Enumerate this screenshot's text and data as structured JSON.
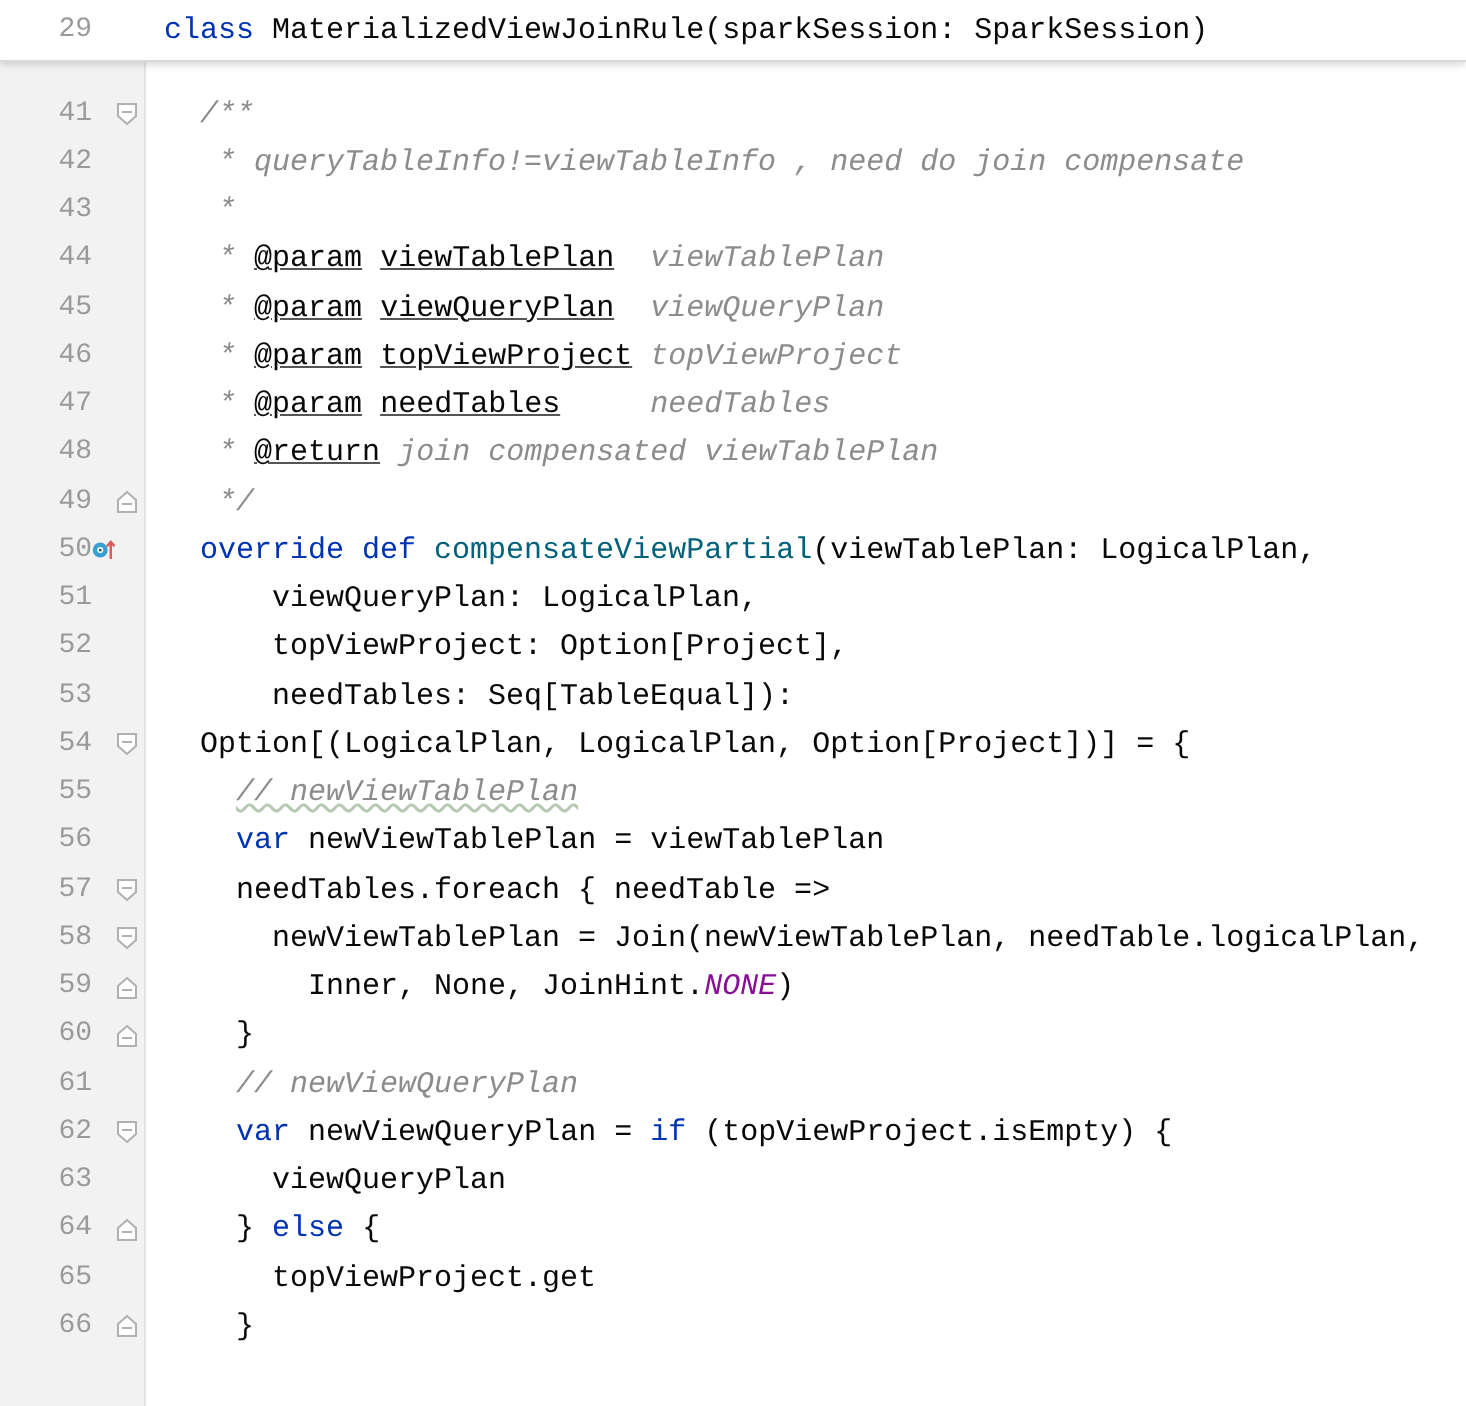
{
  "sticky_line": {
    "number": "29",
    "tokens": [
      {
        "kind": "keyword",
        "text": "class"
      },
      {
        "kind": "plain",
        "text": " MaterializedViewJoinRule(sparkSession: SparkSession)"
      }
    ]
  },
  "lines": [
    {
      "number": "41",
      "fold_start": true,
      "fold_end": false,
      "overrides": false,
      "tokens": [
        {
          "kind": "comment",
          "text": "  /**"
        }
      ]
    },
    {
      "number": "42",
      "fold_start": false,
      "fold_end": false,
      "overrides": false,
      "tokens": [
        {
          "kind": "comment",
          "text": "   * queryTableInfo!=viewTableInfo , need do join compensate"
        }
      ]
    },
    {
      "number": "43",
      "fold_start": false,
      "fold_end": false,
      "overrides": false,
      "tokens": [
        {
          "kind": "comment",
          "text": "   *"
        }
      ]
    },
    {
      "number": "44",
      "fold_start": false,
      "fold_end": false,
      "overrides": false,
      "tokens": [
        {
          "kind": "comment",
          "text": "   * "
        },
        {
          "kind": "doc-tag",
          "text": "@param"
        },
        {
          "kind": "doc-ref",
          "text": " viewTablePlan"
        },
        {
          "kind": "comment",
          "text": "  viewTablePlan"
        }
      ]
    },
    {
      "number": "45",
      "fold_start": false,
      "fold_end": false,
      "overrides": false,
      "tokens": [
        {
          "kind": "comment",
          "text": "   * "
        },
        {
          "kind": "doc-tag",
          "text": "@param"
        },
        {
          "kind": "doc-ref",
          "text": " viewQueryPlan"
        },
        {
          "kind": "comment",
          "text": "  viewQueryPlan"
        }
      ]
    },
    {
      "number": "46",
      "fold_start": false,
      "fold_end": false,
      "overrides": false,
      "tokens": [
        {
          "kind": "comment",
          "text": "   * "
        },
        {
          "kind": "doc-tag",
          "text": "@param"
        },
        {
          "kind": "doc-ref",
          "text": " topViewProject"
        },
        {
          "kind": "comment",
          "text": " topViewProject"
        }
      ]
    },
    {
      "number": "47",
      "fold_start": false,
      "fold_end": false,
      "overrides": false,
      "tokens": [
        {
          "kind": "comment",
          "text": "   * "
        },
        {
          "kind": "doc-tag",
          "text": "@param"
        },
        {
          "kind": "doc-ref",
          "text": " needTables"
        },
        {
          "kind": "comment",
          "text": "     needTables"
        }
      ]
    },
    {
      "number": "48",
      "fold_start": false,
      "fold_end": false,
      "overrides": false,
      "tokens": [
        {
          "kind": "comment",
          "text": "   * "
        },
        {
          "kind": "doc-tag",
          "text": "@return"
        },
        {
          "kind": "comment",
          "text": " join compensated viewTablePlan"
        }
      ]
    },
    {
      "number": "49",
      "fold_start": false,
      "fold_end": true,
      "overrides": false,
      "tokens": [
        {
          "kind": "comment",
          "text": "   */"
        }
      ]
    },
    {
      "number": "50",
      "fold_start": false,
      "fold_end": false,
      "overrides": true,
      "tokens": [
        {
          "kind": "keyword",
          "text": "  override def "
        },
        {
          "kind": "function",
          "text": "compensateViewPartial"
        },
        {
          "kind": "plain",
          "text": "(viewTablePlan: LogicalPlan,"
        }
      ]
    },
    {
      "number": "51",
      "fold_start": false,
      "fold_end": false,
      "overrides": false,
      "tokens": [
        {
          "kind": "plain",
          "text": "      viewQueryPlan: LogicalPlan,"
        }
      ]
    },
    {
      "number": "52",
      "fold_start": false,
      "fold_end": false,
      "overrides": false,
      "tokens": [
        {
          "kind": "plain",
          "text": "      topViewProject: Option[Project],"
        }
      ]
    },
    {
      "number": "53",
      "fold_start": false,
      "fold_end": false,
      "overrides": false,
      "tokens": [
        {
          "kind": "plain",
          "text": "      needTables: Seq[TableEqual]):"
        }
      ]
    },
    {
      "number": "54",
      "fold_start": true,
      "fold_end": false,
      "overrides": false,
      "tokens": [
        {
          "kind": "plain",
          "text": "  Option[(LogicalPlan, LogicalPlan, Option[Project])] = {"
        }
      ]
    },
    {
      "number": "55",
      "fold_start": false,
      "fold_end": false,
      "overrides": false,
      "tokens": [
        {
          "kind": "comment-typo",
          "text": "    // newViewTablePlan"
        }
      ]
    },
    {
      "number": "56",
      "fold_start": false,
      "fold_end": false,
      "overrides": false,
      "tokens": [
        {
          "kind": "keyword",
          "text": "    var"
        },
        {
          "kind": "plain",
          "text": " newViewTablePlan = viewTablePlan"
        }
      ]
    },
    {
      "number": "57",
      "fold_start": true,
      "fold_end": false,
      "overrides": false,
      "tokens": [
        {
          "kind": "plain",
          "text": "    needTables.foreach { needTable =>"
        }
      ]
    },
    {
      "number": "58",
      "fold_start": true,
      "fold_end": false,
      "overrides": false,
      "tokens": [
        {
          "kind": "plain",
          "text": "      newViewTablePlan = Join(newViewTablePlan, needTable.logicalPlan,"
        }
      ]
    },
    {
      "number": "59",
      "fold_start": false,
      "fold_end": true,
      "overrides": false,
      "tokens": [
        {
          "kind": "plain",
          "text": "        Inner, None, JoinHint."
        },
        {
          "kind": "constant",
          "text": "NONE"
        },
        {
          "kind": "plain",
          "text": ")"
        }
      ]
    },
    {
      "number": "60",
      "fold_start": false,
      "fold_end": true,
      "overrides": false,
      "tokens": [
        {
          "kind": "plain",
          "text": "    }"
        }
      ]
    },
    {
      "number": "61",
      "fold_start": false,
      "fold_end": false,
      "overrides": false,
      "tokens": [
        {
          "kind": "comment",
          "text": "    // newViewQueryPlan"
        }
      ]
    },
    {
      "number": "62",
      "fold_start": true,
      "fold_end": false,
      "overrides": false,
      "tokens": [
        {
          "kind": "keyword",
          "text": "    var"
        },
        {
          "kind": "plain",
          "text": " newViewQueryPlan = "
        },
        {
          "kind": "keyword",
          "text": "if"
        },
        {
          "kind": "plain",
          "text": " (topViewProject.isEmpty) {"
        }
      ]
    },
    {
      "number": "63",
      "fold_start": false,
      "fold_end": false,
      "overrides": false,
      "tokens": [
        {
          "kind": "plain",
          "text": "      viewQueryPlan"
        }
      ]
    },
    {
      "number": "64",
      "fold_start": false,
      "fold_end": true,
      "overrides": false,
      "tokens": [
        {
          "kind": "plain",
          "text": "    } "
        },
        {
          "kind": "keyword",
          "text": "else"
        },
        {
          "kind": "plain",
          "text": " {"
        }
      ]
    },
    {
      "number": "65",
      "fold_start": false,
      "fold_end": false,
      "overrides": false,
      "tokens": [
        {
          "kind": "plain",
          "text": "      topViewProject.get"
        }
      ]
    },
    {
      "number": "66",
      "fold_start": false,
      "fold_end": true,
      "overrides": false,
      "tokens": [
        {
          "kind": "plain",
          "text": "    }"
        }
      ]
    }
  ]
}
